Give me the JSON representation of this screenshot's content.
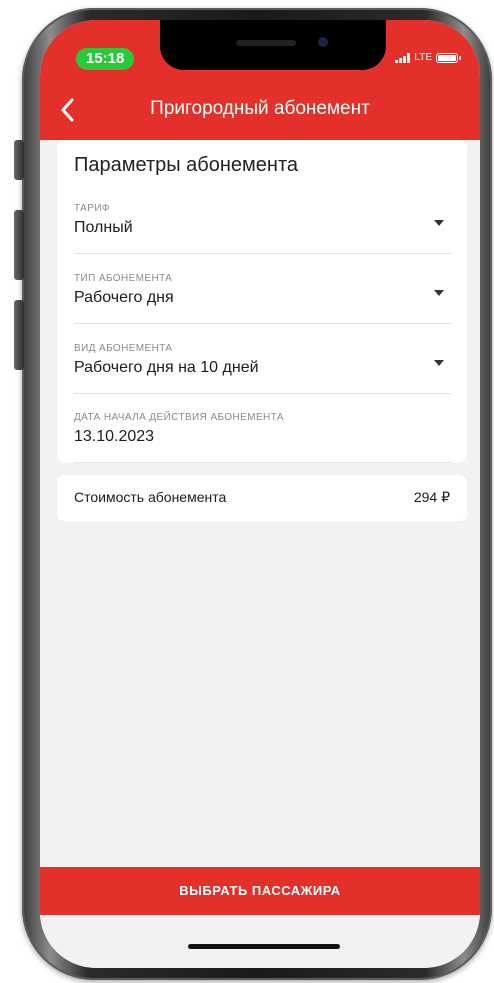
{
  "status_bar": {
    "time": "15:18",
    "network": "LTE"
  },
  "header": {
    "back_icon": "chevron-left-icon",
    "title": "Пригородный абонемент"
  },
  "params": {
    "title": "Параметры абонемента",
    "fields": [
      {
        "label": "ТАРИФ",
        "value": "Полный",
        "dropdown": true
      },
      {
        "label": "ТИП АБОНЕМЕНТА",
        "value": "Рабочего дня",
        "dropdown": true
      },
      {
        "label": "ВИД АБОНЕМЕНТА",
        "value": "Рабочего дня на 10 дней",
        "dropdown": true
      },
      {
        "label": "ДАТА НАЧАЛА ДЕЙСТВИЯ АБОНЕМЕНТА",
        "value": "13.10.2023",
        "dropdown": false
      }
    ]
  },
  "cost": {
    "label": "Стоимость абонемента",
    "value": "294 ₽"
  },
  "cta": {
    "label": "ВЫБРАТЬ ПАССАЖИРА"
  },
  "colors": {
    "brand_red": "#e4302a",
    "status_green": "#2bc93a",
    "background": "#f2f2f2"
  }
}
